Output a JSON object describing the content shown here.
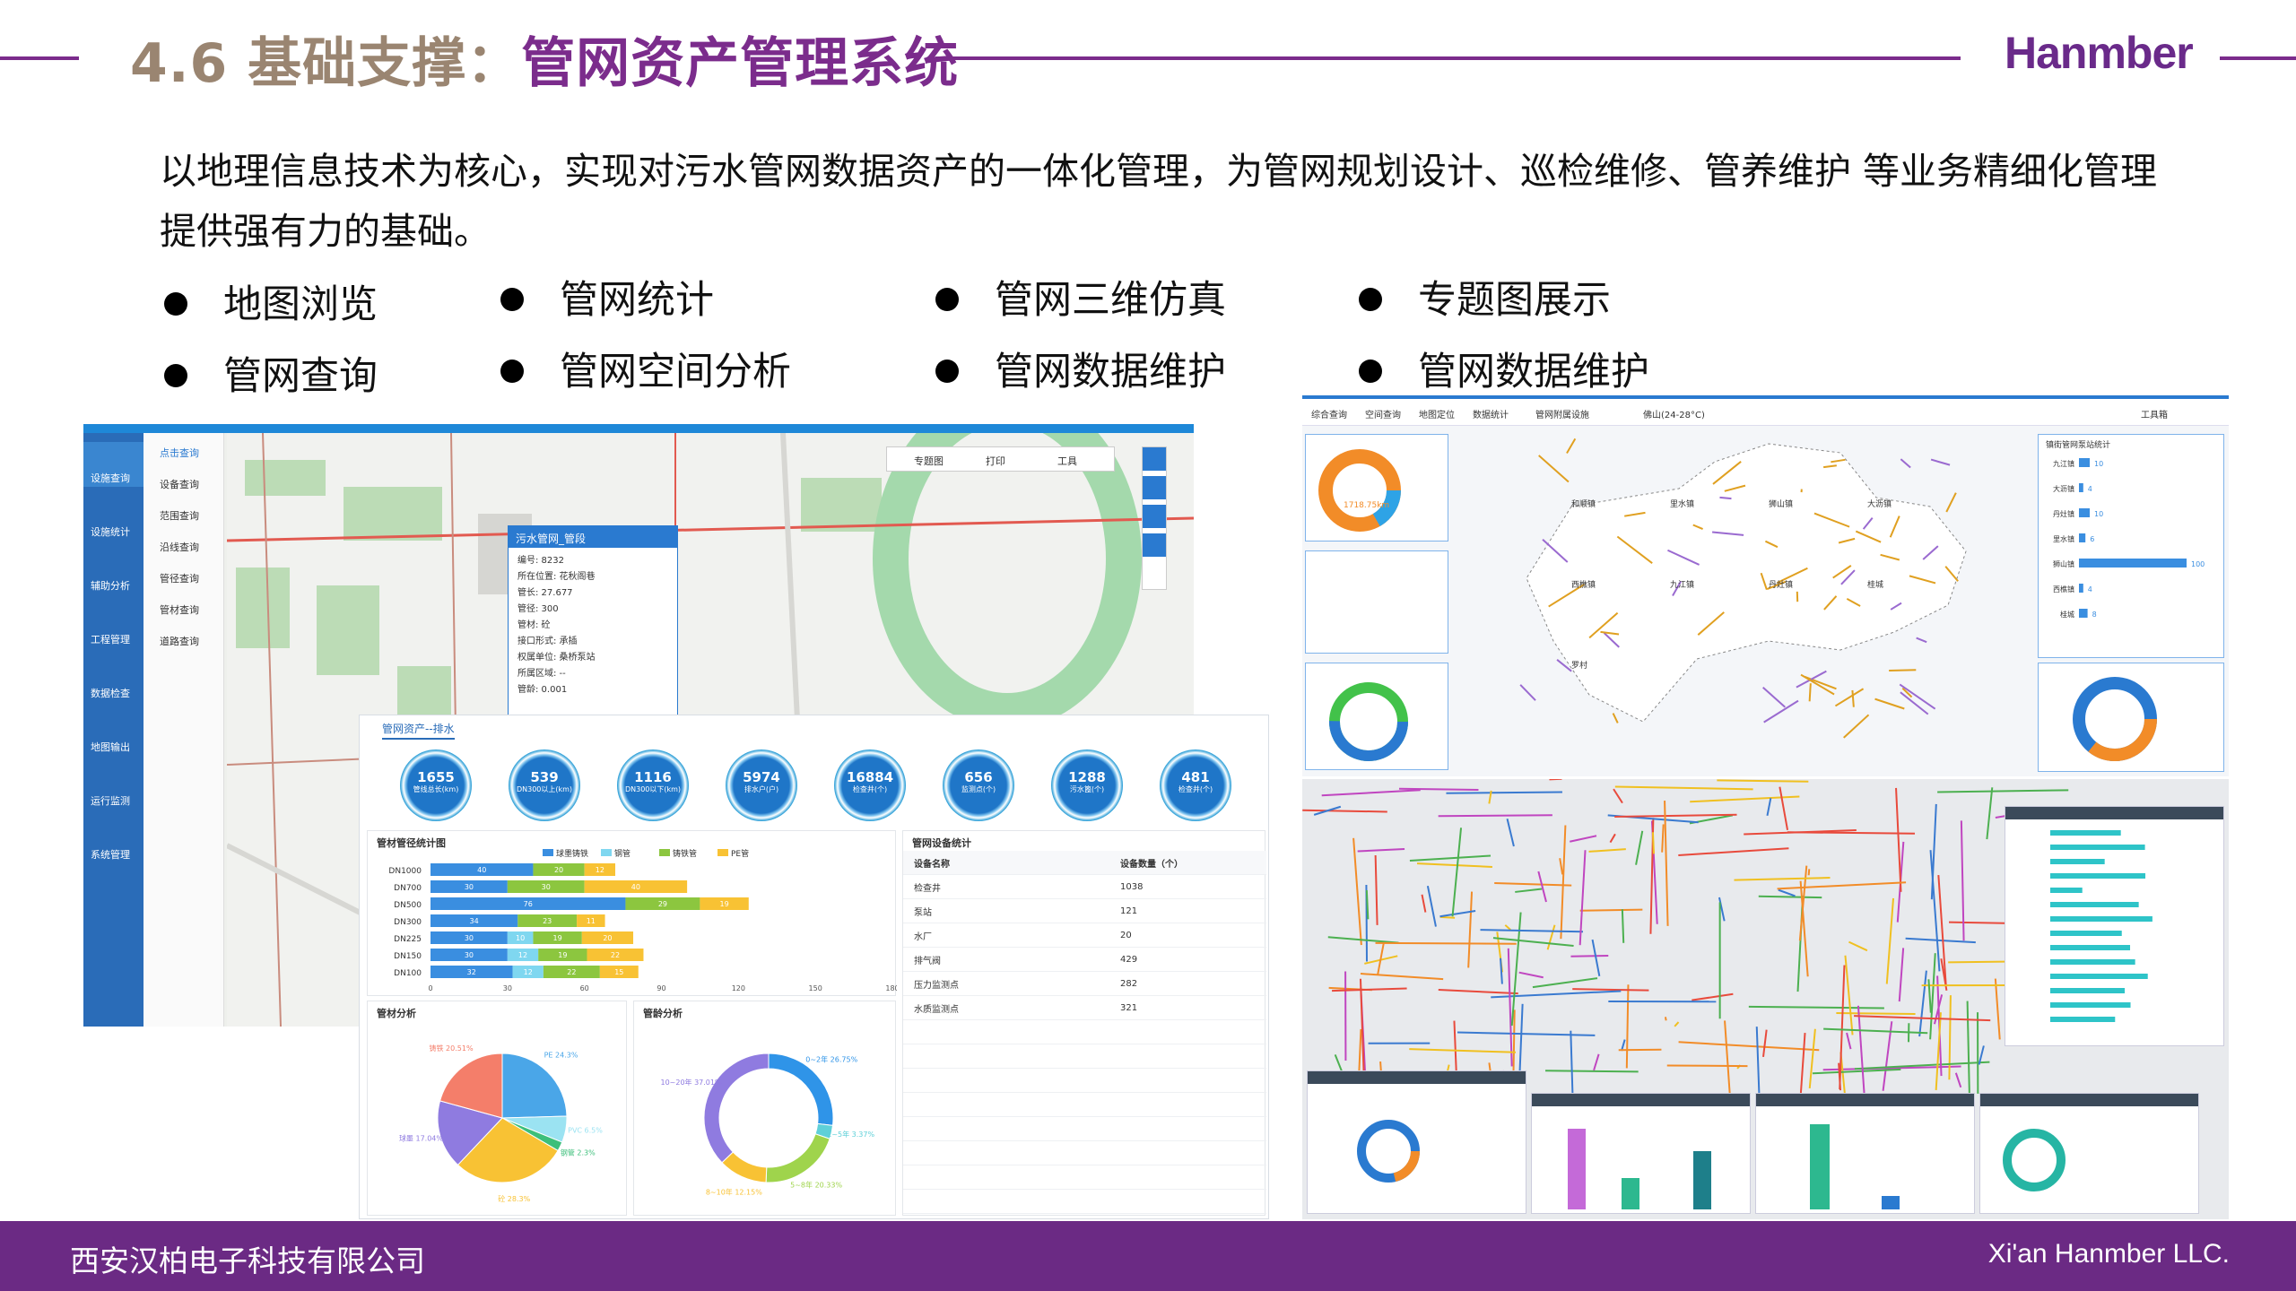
{
  "header": {
    "title_number": "4.6 基础支撑：",
    "title_main": "管网资产管理系统",
    "logo": "Hanmber"
  },
  "intro": "以地理信息技术为核心，实现对污水管网数据资产的一体化管理，为管网规划设计、巡检维修、管养维护 等业务精细化管理提供强有力的基础。",
  "features": [
    "地图浏览",
    "管网统计",
    "管网三维仿真",
    "专题图展示",
    "管网查询",
    "管网空间分析",
    "管网数据维护",
    "管网数据维护"
  ],
  "footer": {
    "company_cn": "西安汉柏电子科技有限公司",
    "company_en": "Xi'an Hanmber LLC."
  },
  "left_app": {
    "sidebar": [
      "设施查询",
      "设施统计",
      "辅助分析",
      "工程管理",
      "数据检查",
      "地图输出",
      "运行监测",
      "系统管理"
    ],
    "subnav": [
      "点击查询",
      "设备查询",
      "范围查询",
      "沿线查询",
      "管径查询",
      "管材查询",
      "道路查询"
    ],
    "toolbar": [
      "专题图",
      "打印",
      "工具"
    ],
    "popup": {
      "title": "污水管网_管段",
      "fields": [
        "编号: 8232",
        "所在位置: 花秋阁巷",
        "管长: 27.677",
        "管径: 300",
        "管材: 砼",
        "接口形式: 承插",
        "权属单位: 桑桥泵站",
        "所属区域: --",
        "管龄: 0.001"
      ]
    }
  },
  "stats_panel": {
    "tab": "管网资产--排水",
    "circles": [
      {
        "v": "1655",
        "l": "管线总长(km)"
      },
      {
        "v": "539",
        "l": "DN300以上(km)"
      },
      {
        "v": "1116",
        "l": "DN300以下(km)"
      },
      {
        "v": "5974",
        "l": "排水户(户)"
      },
      {
        "v": "16884",
        "l": "检查井(个)"
      },
      {
        "v": "656",
        "l": "监测点(个)"
      },
      {
        "v": "1288",
        "l": "污水篦(个)"
      },
      {
        "v": "481",
        "l": "检查井(个)"
      }
    ],
    "bar_title": "管材管径统计图",
    "legend": [
      "球墨铸铁",
      "钢管",
      "铸铁管",
      "PE管"
    ],
    "rows": [
      {
        "c": "DN1000",
        "v": [
          40,
          0,
          20,
          12
        ]
      },
      {
        "c": "DN700",
        "v": [
          30,
          0,
          30,
          40
        ]
      },
      {
        "c": "DN500",
        "v": [
          76,
          0,
          29,
          19
        ]
      },
      {
        "c": "DN300",
        "v": [
          34,
          0,
          23,
          11
        ]
      },
      {
        "c": "DN225",
        "v": [
          30,
          10,
          19,
          20
        ]
      },
      {
        "c": "DN150",
        "v": [
          30,
          12,
          19,
          22
        ]
      },
      {
        "c": "DN100",
        "v": [
          32,
          12,
          22,
          15
        ]
      }
    ],
    "xticks": [
      "0",
      "30",
      "60",
      "90",
      "120",
      "150",
      "180"
    ],
    "table_title": "管网设备统计",
    "table_header": [
      "设备名称",
      "设备数量（个）"
    ],
    "table": [
      [
        "检查井",
        "1038"
      ],
      [
        "泵站",
        "121"
      ],
      [
        "水厂",
        "20"
      ],
      [
        "排气阀",
        "429"
      ],
      [
        "压力监测点",
        "282"
      ],
      [
        "水质监测点",
        "321"
      ]
    ],
    "pie_title": "管材分析",
    "pie": [
      {
        "l": "PE 24.3%",
        "v": 24.3,
        "c": "#4aa6e8"
      },
      {
        "l": "PVC 6.5%",
        "v": 6.5,
        "c": "#9be3f2"
      },
      {
        "l": "钢管 2.3%",
        "v": 2.3,
        "c": "#3cbf7a"
      },
      {
        "l": "砼 28.3%",
        "v": 28.3,
        "c": "#f8c234"
      },
      {
        "l": "球墨 17.04%",
        "v": 17.04,
        "c": "#8f7be0"
      },
      {
        "l": "铸铁 20.51%",
        "v": 20.51,
        "c": "#f47e6a"
      }
    ],
    "donut_title": "管龄分析",
    "donut": [
      {
        "l": "0~2年 26.75%",
        "v": 26.75,
        "c": "#2f94e8"
      },
      {
        "l": "2~5年 3.37%",
        "v": 3.37,
        "c": "#5fd0d8"
      },
      {
        "l": "5~8年 20.33%",
        "v": 20.33,
        "c": "#9fd44c"
      },
      {
        "l": "8~10年 12.15%",
        "v": 12.15,
        "c": "#f8c234"
      },
      {
        "l": "10~20年 37.01%",
        "v": 37.01,
        "c": "#8f7be0"
      }
    ]
  },
  "right_app": {
    "top_tabs": [
      "综合查询",
      "空间查询",
      "地图定位",
      "数据统计",
      "管网附属设施"
    ],
    "weather": "佛山(24-28°C)",
    "tool": "工具箱",
    "ring_center": "1718.75km",
    "bar_title": "镇街管网泵站统计",
    "bars": [
      {
        "c": "九江镇",
        "v": 10
      },
      {
        "c": "大沥镇",
        "v": 4
      },
      {
        "c": "丹灶镇",
        "v": 10
      },
      {
        "c": "里水镇",
        "v": 6
      },
      {
        "c": "狮山镇",
        "v": 100
      },
      {
        "c": "西樵镇",
        "v": 4
      },
      {
        "c": "桂城",
        "v": 8
      }
    ],
    "towns": [
      "和顺镇",
      "里水镇",
      "狮山镇",
      "大沥镇",
      "西樵镇",
      "九江镇",
      "丹灶镇",
      "桂城",
      "罗村"
    ]
  }
}
